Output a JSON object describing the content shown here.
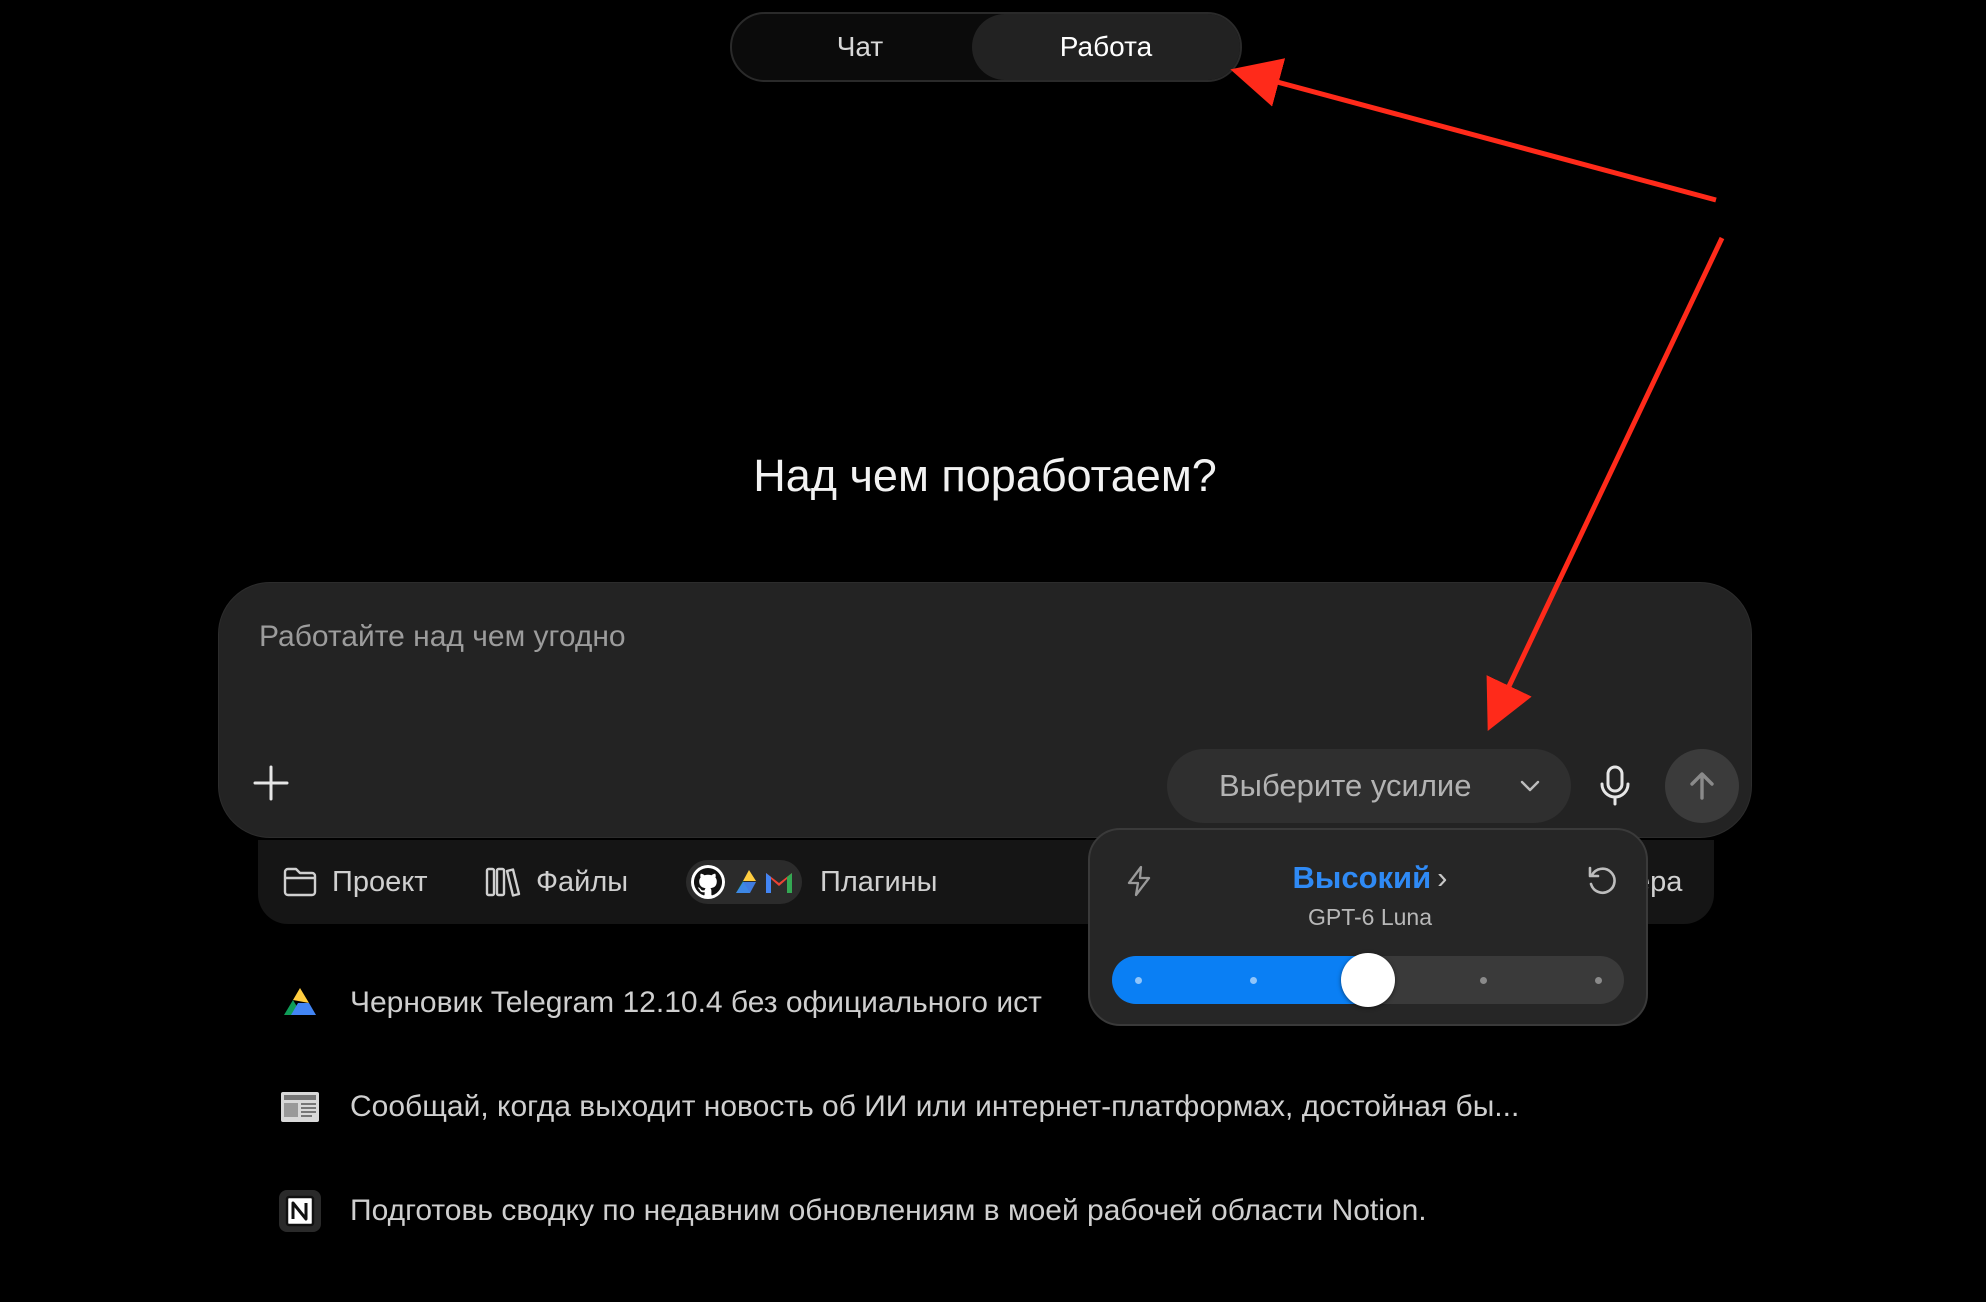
{
  "mode_toggle": {
    "chat_label": "Чат",
    "work_label": "Работа",
    "active": "Работа"
  },
  "heading": "Над чем поработаем?",
  "composer": {
    "placeholder": "Работайте над чем угодно",
    "effort_select_label": "Выберите усилие"
  },
  "tools": {
    "project_label": "Проект",
    "files_label": "Файлы",
    "plugins_label": "Плагины",
    "plugin_icons": [
      "github-icon",
      "google-drive-icon",
      "gmail-icon"
    ],
    "partial_label": "ера"
  },
  "effort_popup": {
    "level_label": "Высокий",
    "model_label": "GPT-6 Luna",
    "slider_steps": 5,
    "slider_value_index": 2,
    "accent_color": "#0a7ff4"
  },
  "suggestions": [
    {
      "icon": "google-drive-icon",
      "text": "Черновик Telegram 12.10.4 без официального ист"
    },
    {
      "icon": "newspaper-icon",
      "text": "Сообщай, когда выходит новость об ИИ или интернет-платформах, достойная бы..."
    },
    {
      "icon": "notion-icon",
      "text": "Подготовь сводку по недавним обновлениям в моей рабочей области Notion."
    }
  ],
  "annotation_color": "#ff2a1a"
}
